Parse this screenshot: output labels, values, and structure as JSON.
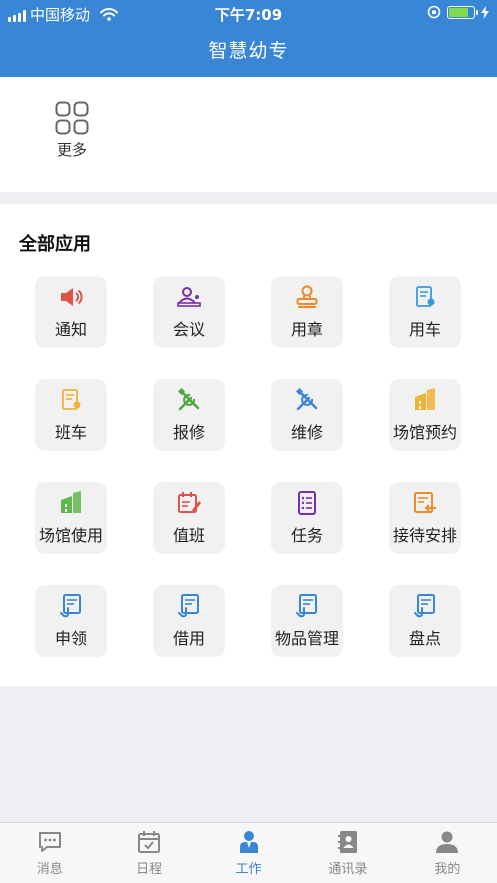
{
  "status_bar": {
    "carrier": "中国移动",
    "time": "下午7:09"
  },
  "header": {
    "title": "智慧幼专"
  },
  "more": {
    "label": "更多"
  },
  "apps": {
    "title": "全部应用",
    "items": [
      {
        "label": "通知",
        "icon": "megaphone-icon",
        "color": "#e0534a"
      },
      {
        "label": "会议",
        "icon": "meeting-icon",
        "color": "#7a2fa8"
      },
      {
        "label": "用章",
        "icon": "stamp-icon",
        "color": "#f0892a"
      },
      {
        "label": "用车",
        "icon": "car-document-icon",
        "color": "#3a9bd9"
      },
      {
        "label": "班车",
        "icon": "bus-document-icon",
        "color": "#f2b236"
      },
      {
        "label": "报修",
        "icon": "repair-tools-icon",
        "color": "#49a83c"
      },
      {
        "label": "维修",
        "icon": "maintenance-tools-icon",
        "color": "#3a86d6"
      },
      {
        "label": "场馆预约",
        "icon": "venue-building-icon",
        "color": "#f2b236"
      },
      {
        "label": "场馆使用",
        "icon": "venue-building-icon",
        "color": "#5fb84a"
      },
      {
        "label": "值班",
        "icon": "duty-calendar-icon",
        "color": "#e0534a"
      },
      {
        "label": "任务",
        "icon": "task-list-icon",
        "color": "#7a2fa8"
      },
      {
        "label": "接待安排",
        "icon": "reception-document-icon",
        "color": "#f0892a"
      },
      {
        "label": "申领",
        "icon": "apply-document-icon",
        "color": "#3a86d6"
      },
      {
        "label": "借用",
        "icon": "borrow-document-icon",
        "color": "#3a86d6"
      },
      {
        "label": "物品管理",
        "icon": "goods-document-icon",
        "color": "#3a86d6"
      },
      {
        "label": "盘点",
        "icon": "inventory-document-icon",
        "color": "#3a86d6"
      }
    ]
  },
  "tab_bar": {
    "items": [
      {
        "label": "消息",
        "icon": "message-icon",
        "active": false
      },
      {
        "label": "日程",
        "icon": "calendar-icon",
        "active": false
      },
      {
        "label": "工作",
        "icon": "work-person-icon",
        "active": true
      },
      {
        "label": "通讯录",
        "icon": "contacts-icon",
        "active": false
      },
      {
        "label": "我的",
        "icon": "profile-icon",
        "active": false
      }
    ]
  },
  "colors": {
    "brand": "#3a86d6",
    "tile_background": "#f1f1f2",
    "inactive_tab": "#888888"
  }
}
